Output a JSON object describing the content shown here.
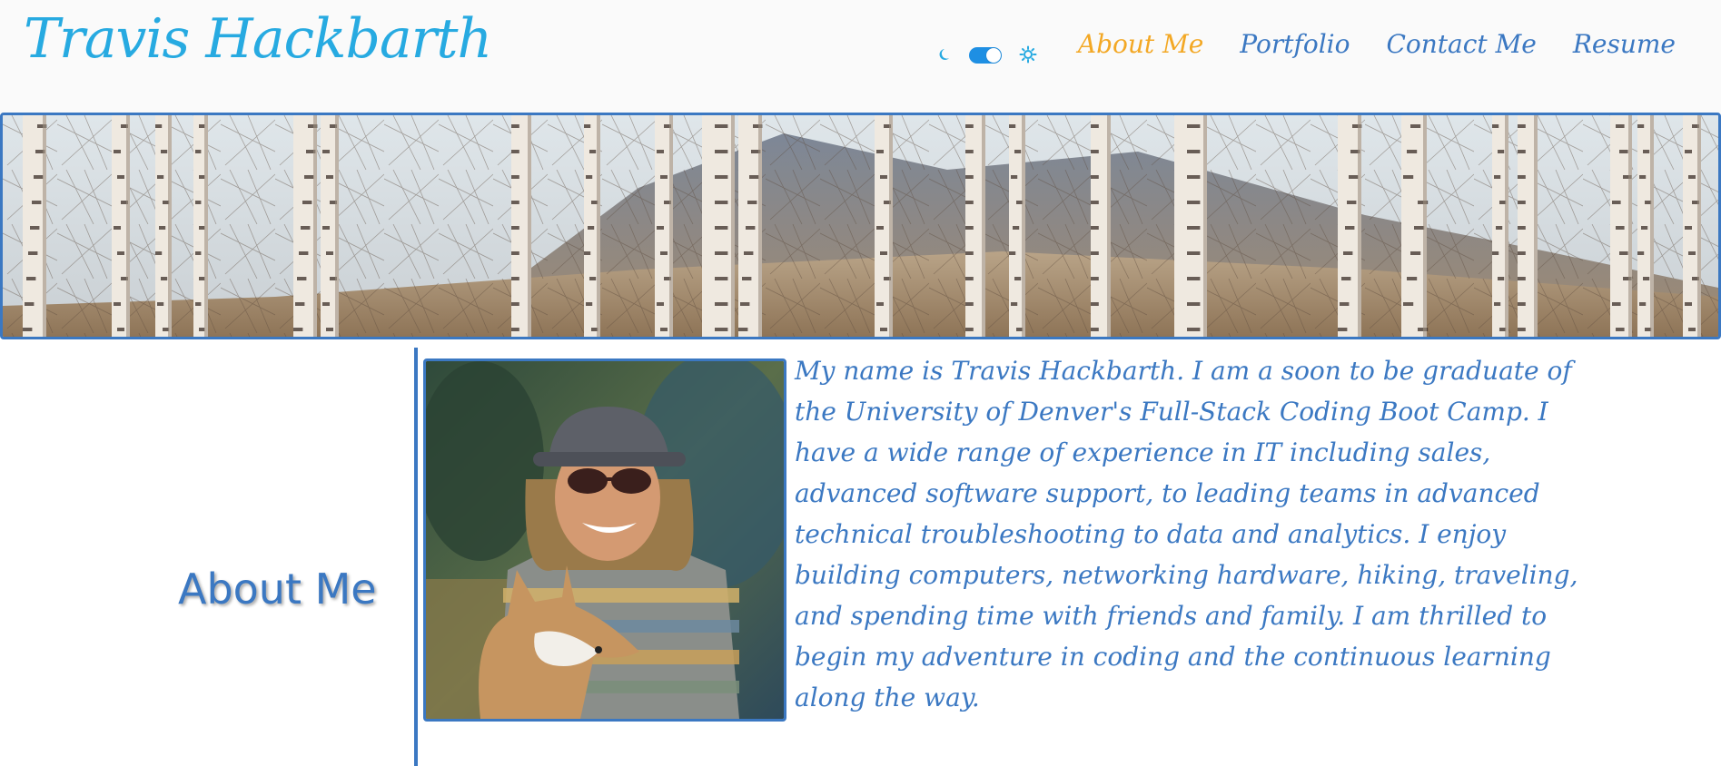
{
  "header": {
    "title": "Travis Hackbarth",
    "theme_toggle": {
      "left_icon": "moon-icon",
      "right_icon": "sun-gear-icon",
      "state": "on",
      "accent": "#1e8fe3"
    },
    "nav": [
      {
        "label": "About Me",
        "active": true
      },
      {
        "label": "Portfolio",
        "active": false
      },
      {
        "label": "Contact Me",
        "active": false
      },
      {
        "label": "Resume",
        "active": false
      }
    ]
  },
  "banner": {
    "description_icon": "birch-forest-banner-image"
  },
  "about": {
    "heading": "About Me",
    "photo_icon": "profile-photo-with-dog",
    "text": "My name is Travis Hackbarth. I am a soon to be graduate of the University of Denver's Full-Stack Coding Boot Camp. I have a wide range of experience in IT including sales, advanced software support, to leading teams in advanced technical troubleshooting to data and analytics. I enjoy building computers, networking hardware, hiking, traveling, and spending time with friends and family. I am thrilled to begin my adventure in coding and the continuous learning along the way."
  },
  "colors": {
    "title": "#27aae1",
    "primary": "#3b78c2",
    "active_nav": "#f3a825",
    "header_bg": "#fafafa"
  }
}
